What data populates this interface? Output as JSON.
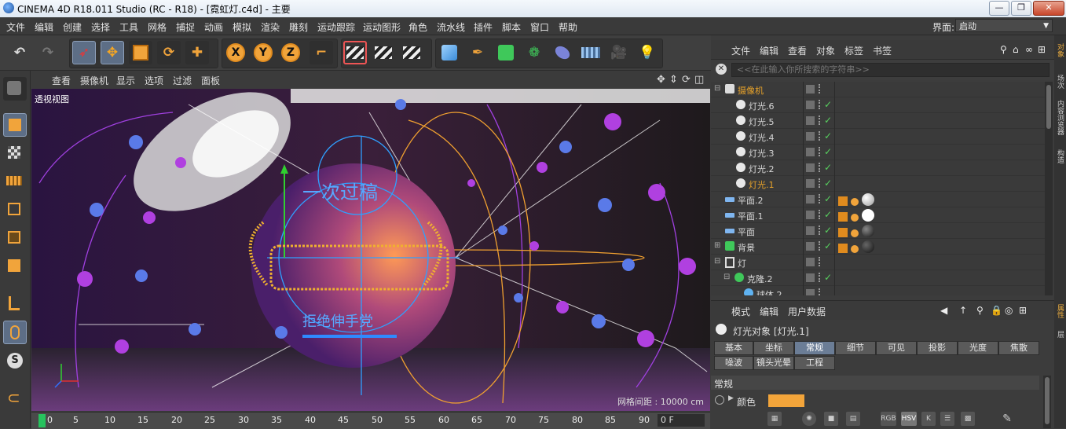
{
  "window": {
    "title": "CINEMA 4D R18.011 Studio (RC - R18) - [霓虹灯.c4d] - 主要",
    "min_label": "—",
    "max_label": "❐",
    "close_label": "✕"
  },
  "menubar": {
    "items": [
      "文件",
      "编辑",
      "创建",
      "选择",
      "工具",
      "网格",
      "捕捉",
      "动画",
      "模拟",
      "渲染",
      "雕刻",
      "运动跟踪",
      "运动图形",
      "角色",
      "流水线",
      "插件",
      "脚本",
      "窗口",
      "帮助"
    ],
    "layout_label": "界面:",
    "layout_value": "启动"
  },
  "toolbar": {
    "axis_x": "X",
    "axis_y": "Y",
    "axis_z": "Z"
  },
  "viewport": {
    "menu": [
      "查看",
      "摄像机",
      "显示",
      "选项",
      "过滤",
      "面板"
    ],
    "view_label": "透视视图",
    "grid_distance": "网格间距 : 10000 cm",
    "scene_text_top": "一次过稿",
    "scene_text_bottom": "拒绝伸手党"
  },
  "timeline": {
    "ticks": [
      "0",
      "5",
      "10",
      "15",
      "20",
      "25",
      "30",
      "35",
      "40",
      "45",
      "50",
      "55",
      "60",
      "65",
      "70",
      "75",
      "80",
      "85",
      "90"
    ],
    "frame": "0 F"
  },
  "object_manager": {
    "menu": [
      "文件",
      "编辑",
      "查看",
      "对象",
      "标签",
      "书签"
    ],
    "search_placeholder": "<<在此输入你所搜索的字符串>>",
    "rows": [
      {
        "name": "摄像机",
        "indent": 0,
        "active": true
      },
      {
        "name": "灯光.6",
        "indent": 1,
        "active": false
      },
      {
        "name": "灯光.5",
        "indent": 1,
        "active": false
      },
      {
        "name": "灯光.4",
        "indent": 1,
        "active": false
      },
      {
        "name": "灯光.3",
        "indent": 1,
        "active": false
      },
      {
        "name": "灯光.2",
        "indent": 1,
        "active": false
      },
      {
        "name": "灯光.1",
        "indent": 1,
        "active": true
      },
      {
        "name": "平面.2",
        "indent": 0,
        "active": false
      },
      {
        "name": "平面.1",
        "indent": 0,
        "active": false
      },
      {
        "name": "平面",
        "indent": 0,
        "active": false
      },
      {
        "name": "背景",
        "indent": 0,
        "active": false
      },
      {
        "name": "灯",
        "indent": 0,
        "active": false
      },
      {
        "name": "克隆.2",
        "indent": 1,
        "active": false
      },
      {
        "name": "球体.2",
        "indent": 2,
        "active": false
      }
    ]
  },
  "attribute_manager": {
    "menu": [
      "模式",
      "编辑",
      "用户数据"
    ],
    "title": "灯光对象 [灯光.1]",
    "tabs_row1": [
      "基本",
      "坐标",
      "常规",
      "细节",
      "可见",
      "投影",
      "光度",
      "焦散"
    ],
    "tabs_row2": [
      "噪波",
      "镜头光晕",
      "工程"
    ],
    "active_tab": "常规",
    "section": "常规",
    "color_label": "颜色",
    "color_value": "#f2a43a",
    "icon_labels": [
      "RGB",
      "HSV",
      "K"
    ]
  },
  "right_tabs": [
    "对象",
    "场次",
    "内容浏览器",
    "构造",
    "属性",
    "层"
  ],
  "colors": {
    "accent_orange": "#e8a32a",
    "selection_blue": "#5d6e86",
    "check_green": "#58d15f"
  }
}
